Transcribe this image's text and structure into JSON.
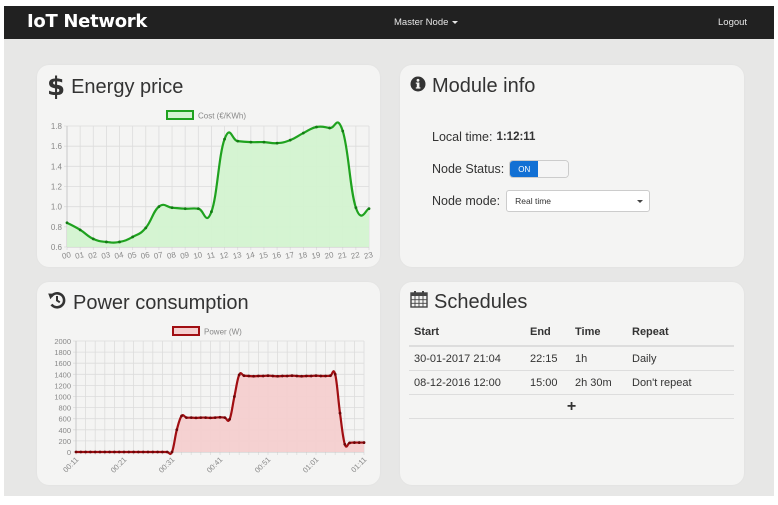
{
  "navbar": {
    "brand": "IoT Network",
    "node_menu": "Master Node",
    "logout": "Logout"
  },
  "energy": {
    "title": "Energy price",
    "icon": "dollar-icon"
  },
  "module": {
    "title": "Module info",
    "icon": "info-circle-icon",
    "local_time_label": "Local time:",
    "local_time_value": "1:12:11",
    "status_label": "Node Status:",
    "status_toggle_label": "ON",
    "status_on": true,
    "mode_label": "Node mode:",
    "mode_value": "Real time"
  },
  "power": {
    "title": "Power consumption",
    "icon": "history-icon"
  },
  "schedules": {
    "title": "Schedules",
    "icon": "calendar-icon",
    "columns": [
      "Start",
      "End",
      "Time",
      "Repeat"
    ],
    "rows": [
      {
        "start": "30-01-2017 21:04",
        "end": "22:15",
        "time": "1h",
        "repeat": "Daily"
      },
      {
        "start": "08-12-2016 12:00",
        "end": "15:00",
        "time": "2h 30m",
        "repeat": "Don't repeat"
      }
    ],
    "add_label": "+"
  },
  "colors": {
    "navbar": "#212121",
    "energy_line": "#1fa21f",
    "energy_fill": "#d3f3d0",
    "power_line": "#a10e12",
    "power_fill": "#f4cfcf",
    "toggle_on": "#1270d4"
  },
  "chart_data": [
    {
      "type": "area",
      "title": "Energy price",
      "legend": [
        "Cost (€/KWh)"
      ],
      "legend_position": "top-center",
      "xlabel": "",
      "ylabel": "",
      "categories": [
        "00",
        "01",
        "02",
        "03",
        "04",
        "05",
        "06",
        "07",
        "08",
        "09",
        "10",
        "11",
        "12",
        "13",
        "14",
        "15",
        "16",
        "17",
        "18",
        "19",
        "20",
        "21",
        "22",
        "23"
      ],
      "values": [
        0.84,
        0.77,
        0.68,
        0.65,
        0.65,
        0.7,
        0.79,
        1.0,
        0.99,
        0.98,
        0.98,
        0.95,
        1.67,
        1.65,
        1.64,
        1.64,
        1.63,
        1.66,
        1.73,
        1.79,
        1.78,
        1.75,
        0.99,
        0.98
      ],
      "ylim": [
        0.6,
        1.8
      ],
      "y_ticks": [
        "0.6",
        "0.8",
        "1.0",
        "1.2",
        "1.4",
        "1.6",
        "1.8"
      ],
      "grid": true
    },
    {
      "type": "area",
      "title": "Power consumption",
      "legend": [
        "Power (W)"
      ],
      "legend_position": "top-center",
      "xlabel": "",
      "ylabel": "",
      "x": [
        "00:11",
        "00:12",
        "00:13",
        "00:14",
        "00:15",
        "00:16",
        "00:17",
        "00:18",
        "00:19",
        "00:20",
        "00:21",
        "00:22",
        "00:23",
        "00:24",
        "00:25",
        "00:26",
        "00:27",
        "00:28",
        "00:29",
        "00:30",
        "00:31",
        "00:32",
        "00:33",
        "00:34",
        "00:35",
        "00:36",
        "00:37",
        "00:38",
        "00:39",
        "00:40",
        "00:41",
        "00:42",
        "00:43",
        "00:44",
        "00:45",
        "00:46",
        "00:47",
        "00:48",
        "00:49",
        "00:50",
        "00:51",
        "00:52",
        "00:53",
        "00:54",
        "00:55",
        "00:56",
        "00:57",
        "00:58",
        "00:59",
        "01:00",
        "01:01",
        "01:02",
        "01:03",
        "01:04",
        "01:05",
        "01:06",
        "01:07",
        "01:08",
        "01:09",
        "01:10",
        "01:11"
      ],
      "values": [
        0,
        0,
        0,
        0,
        0,
        0,
        0,
        0,
        0,
        0,
        0,
        0,
        0,
        0,
        0,
        0,
        0,
        0,
        0,
        0,
        0,
        400,
        650,
        620,
        620,
        615,
        620,
        620,
        615,
        620,
        625,
        620,
        590,
        1000,
        1390,
        1375,
        1370,
        1365,
        1370,
        1370,
        1375,
        1370,
        1365,
        1370,
        1370,
        1375,
        1370,
        1365,
        1370,
        1370,
        1375,
        1370,
        1370,
        1375,
        1400,
        700,
        140,
        165,
        170,
        170,
        170
      ],
      "x_tick_labels": [
        "00:11",
        "00:21",
        "00:31",
        "00:41",
        "00:51",
        "01:01",
        "01:11"
      ],
      "ylim": [
        0,
        2000
      ],
      "y_ticks": [
        "0",
        "200",
        "400",
        "600",
        "800",
        "1000",
        "1200",
        "1400",
        "1600",
        "1800",
        "2000"
      ],
      "grid": true
    }
  ]
}
